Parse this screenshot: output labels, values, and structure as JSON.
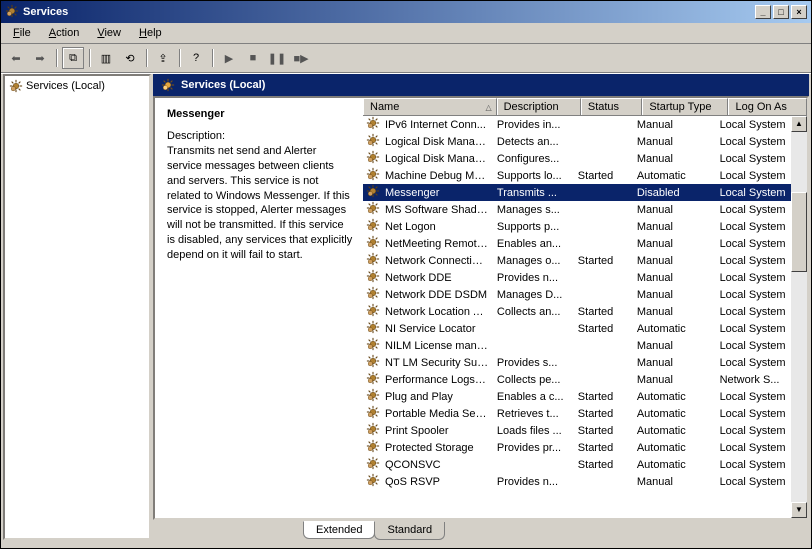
{
  "window": {
    "title": "Services",
    "buttons": {
      "min": "_",
      "max": "□",
      "close": "×"
    }
  },
  "menu": [
    "File",
    "Action",
    "View",
    "Help"
  ],
  "tree": {
    "root": "Services (Local)"
  },
  "header": {
    "title": "Services (Local)"
  },
  "detail": {
    "name": "Messenger",
    "desc_label": "Description:",
    "description": "Transmits net send and Alerter service messages between clients and servers. This service is not related to Windows Messenger. If this service is stopped, Alerter messages will not be transmitted. If this service is disabled, any services that explicitly depend on it will fail to start."
  },
  "columns": {
    "name": "Name",
    "desc": "Description",
    "status": "Status",
    "startup": "Startup Type",
    "logon": "Log On As"
  },
  "services": [
    {
      "name": "IPv6 Internet Conn...",
      "desc": "Provides in...",
      "status": "",
      "startup": "Manual",
      "logon": "Local System"
    },
    {
      "name": "Logical Disk Manager",
      "desc": "Detects an...",
      "status": "",
      "startup": "Manual",
      "logon": "Local System"
    },
    {
      "name": "Logical Disk Manage...",
      "desc": "Configures...",
      "status": "",
      "startup": "Manual",
      "logon": "Local System"
    },
    {
      "name": "Machine Debug Man...",
      "desc": "Supports lo...",
      "status": "Started",
      "startup": "Automatic",
      "logon": "Local System"
    },
    {
      "name": "Messenger",
      "desc": "Transmits ...",
      "status": "",
      "startup": "Disabled",
      "logon": "Local System",
      "selected": true
    },
    {
      "name": "MS Software Shado...",
      "desc": "Manages s...",
      "status": "",
      "startup": "Manual",
      "logon": "Local System"
    },
    {
      "name": "Net Logon",
      "desc": "Supports p...",
      "status": "",
      "startup": "Manual",
      "logon": "Local System"
    },
    {
      "name": "NetMeeting Remote...",
      "desc": "Enables an...",
      "status": "",
      "startup": "Manual",
      "logon": "Local System"
    },
    {
      "name": "Network Connections",
      "desc": "Manages o...",
      "status": "Started",
      "startup": "Manual",
      "logon": "Local System"
    },
    {
      "name": "Network DDE",
      "desc": "Provides n...",
      "status": "",
      "startup": "Manual",
      "logon": "Local System"
    },
    {
      "name": "Network DDE DSDM",
      "desc": "Manages D...",
      "status": "",
      "startup": "Manual",
      "logon": "Local System"
    },
    {
      "name": "Network Location A...",
      "desc": "Collects an...",
      "status": "Started",
      "startup": "Manual",
      "logon": "Local System"
    },
    {
      "name": "NI Service Locator",
      "desc": "",
      "status": "Started",
      "startup": "Automatic",
      "logon": "Local System"
    },
    {
      "name": "NILM License manager",
      "desc": "",
      "status": "",
      "startup": "Manual",
      "logon": "Local System"
    },
    {
      "name": "NT LM Security Sup...",
      "desc": "Provides s...",
      "status": "",
      "startup": "Manual",
      "logon": "Local System"
    },
    {
      "name": "Performance Logs a...",
      "desc": "Collects pe...",
      "status": "",
      "startup": "Manual",
      "logon": "Network S..."
    },
    {
      "name": "Plug and Play",
      "desc": "Enables a c...",
      "status": "Started",
      "startup": "Automatic",
      "logon": "Local System"
    },
    {
      "name": "Portable Media Seri...",
      "desc": "Retrieves t...",
      "status": "Started",
      "startup": "Automatic",
      "logon": "Local System"
    },
    {
      "name": "Print Spooler",
      "desc": "Loads files ...",
      "status": "Started",
      "startup": "Automatic",
      "logon": "Local System"
    },
    {
      "name": "Protected Storage",
      "desc": "Provides pr...",
      "status": "Started",
      "startup": "Automatic",
      "logon": "Local System"
    },
    {
      "name": "QCONSVC",
      "desc": "",
      "status": "Started",
      "startup": "Automatic",
      "logon": "Local System"
    },
    {
      "name": "QoS RSVP",
      "desc": "Provides n...",
      "status": "",
      "startup": "Manual",
      "logon": "Local System"
    }
  ],
  "tabs": {
    "extended": "Extended",
    "standard": "Standard"
  }
}
